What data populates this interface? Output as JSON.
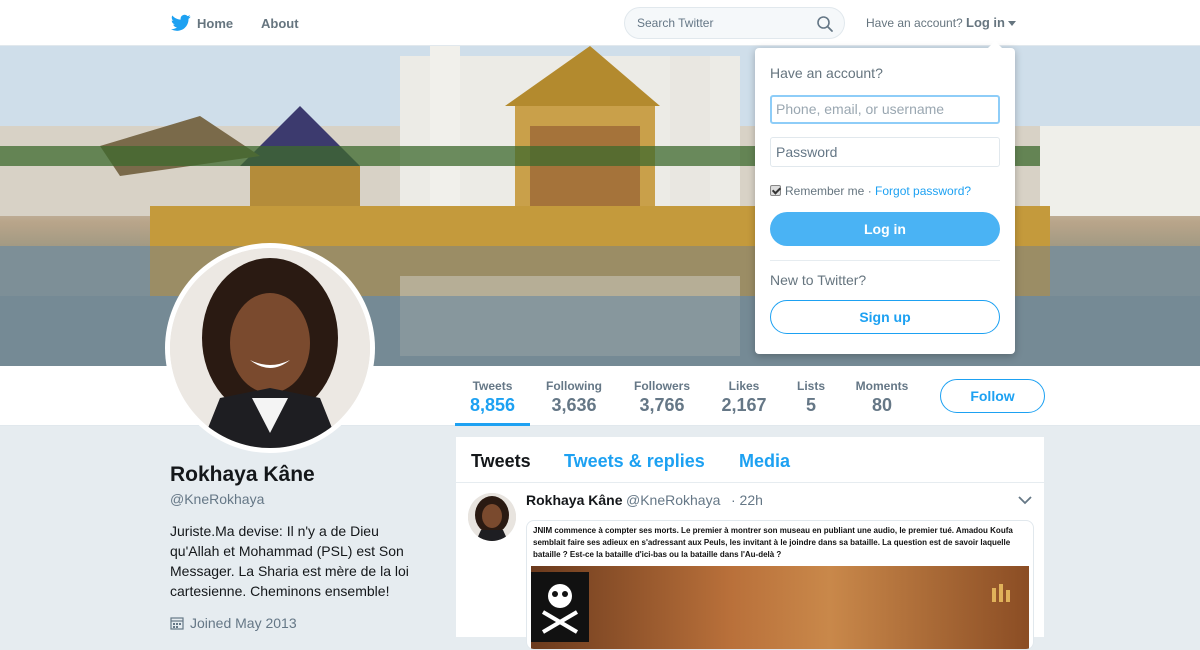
{
  "topbar": {
    "home_label": "Home",
    "about_label": "About",
    "search_placeholder": "Search Twitter",
    "account_prompt": "Have an account?",
    "login_label": "Log in"
  },
  "profile": {
    "name": "Rokhaya Kâne",
    "handle": "@KneRokhaya",
    "bio": "Juriste.Ma devise: Il n'y a de Dieu qu'Allah et Mohammad (PSL) est Son Messager. La Sharia est mère de la loi cartesienne. Cheminons ensemble!",
    "joined": "Joined May 2013"
  },
  "stats": [
    {
      "label": "Tweets",
      "value": "8,856"
    },
    {
      "label": "Following",
      "value": "3,636"
    },
    {
      "label": "Followers",
      "value": "3,766"
    },
    {
      "label": "Likes",
      "value": "2,167"
    },
    {
      "label": "Lists",
      "value": "5"
    },
    {
      "label": "Moments",
      "value": "80"
    }
  ],
  "follow_label": "Follow",
  "timeline": {
    "tabs": [
      "Tweets",
      "Tweets & replies",
      "Media"
    ],
    "tweet": {
      "name": "Rokhaya Kâne",
      "handle": "@KneRokhaya",
      "time": "· 22h",
      "card_text": "JNIM commence à compter ses morts. Le premier à montrer son museau en publiant une audio, le premier tué. Amadou Koufa semblait faire ses adieux en s'adressant aux Peuls, les invitant à le joindre dans sa bataille. La question est de savoir laquelle bataille ?      Est-ce la bataille d'ici-bas ou la bataille dans l'Au-delà ?"
    }
  },
  "login_dropdown": {
    "title": "Have an account?",
    "username_placeholder": "Phone, email, or username",
    "password_placeholder": "Password",
    "remember_label": "Remember me",
    "separator": " · ",
    "forgot_label": "Forgot password?",
    "login_button": "Log in",
    "new_prompt": "New to Twitter?",
    "signup_button": "Sign up"
  },
  "colors": {
    "accent": "#1da1f2",
    "login_button_bg": "#4ab3f4",
    "page_bg": "#e6ecf0"
  },
  "icons": [
    "twitter-bird-icon",
    "search-icon",
    "caret-down-icon",
    "calendar-icon",
    "chevron-down-icon",
    "skull-icon"
  ]
}
